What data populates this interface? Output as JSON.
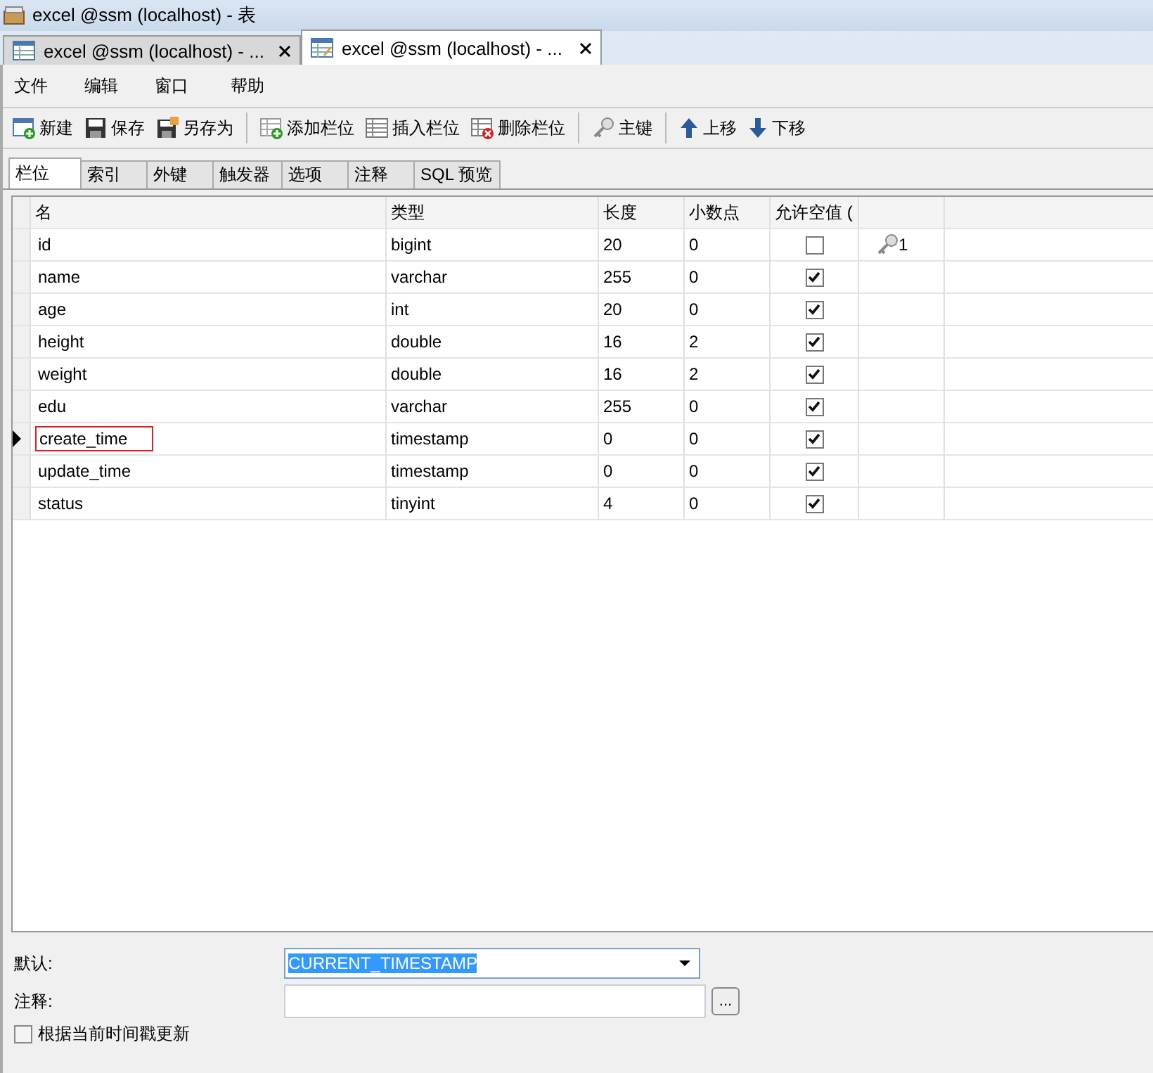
{
  "window": {
    "title": "excel @ssm (localhost) - 表"
  },
  "doc_tabs": [
    {
      "label": "excel @ssm (localhost) - ...",
      "selected": false
    },
    {
      "label": "excel @ssm (localhost) - ...",
      "selected": true
    }
  ],
  "menu": [
    "文件",
    "编辑",
    "窗口",
    "帮助"
  ],
  "toolbar": [
    {
      "label": "新建"
    },
    {
      "label": "保存"
    },
    {
      "label": "另存为"
    },
    {
      "label": "添加栏位"
    },
    {
      "label": "插入栏位"
    },
    {
      "label": "删除栏位"
    },
    {
      "label": "主键"
    },
    {
      "label": "上移"
    },
    {
      "label": "下移"
    }
  ],
  "tabs": [
    {
      "label": "栏位",
      "selected": true
    },
    {
      "label": "索引",
      "selected": false
    },
    {
      "label": "外键",
      "selected": false
    },
    {
      "label": "触发器",
      "selected": false
    },
    {
      "label": "选项",
      "selected": false
    },
    {
      "label": "注释",
      "selected": false
    },
    {
      "label": "SQL 预览",
      "selected": false
    }
  ],
  "table": {
    "columns": [
      "名",
      "类型",
      "长度",
      "小数点",
      "允许空值 ("
    ],
    "rows": [
      {
        "name": "id",
        "type": "bigint",
        "length": "20",
        "decimals": "0",
        "allow_null": false,
        "key": "1",
        "selected": false
      },
      {
        "name": "name",
        "type": "varchar",
        "length": "255",
        "decimals": "0",
        "allow_null": true,
        "selected": false
      },
      {
        "name": "age",
        "type": "int",
        "length": "20",
        "decimals": "0",
        "allow_null": true,
        "selected": false
      },
      {
        "name": "height",
        "type": "double",
        "length": "16",
        "decimals": "2",
        "allow_null": true,
        "selected": false
      },
      {
        "name": "weight",
        "type": "double",
        "length": "16",
        "decimals": "2",
        "allow_null": true,
        "selected": false
      },
      {
        "name": "edu",
        "type": "varchar",
        "length": "255",
        "decimals": "0",
        "allow_null": true,
        "selected": false
      },
      {
        "name": "create_time",
        "type": "timestamp",
        "length": "0",
        "decimals": "0",
        "allow_null": true,
        "selected": true
      },
      {
        "name": "update_time",
        "type": "timestamp",
        "length": "0",
        "decimals": "0",
        "allow_null": true,
        "selected": false
      },
      {
        "name": "status",
        "type": "tinyint",
        "length": "4",
        "decimals": "0",
        "allow_null": true,
        "selected": false
      }
    ]
  },
  "properties": {
    "default_label": "默认:",
    "default_value": "CURRENT_TIMESTAMP",
    "comment_label": "注释:",
    "comment_button": "...",
    "update_checkbox": {
      "label": "根据当前时间戳更新",
      "checked": false
    }
  }
}
